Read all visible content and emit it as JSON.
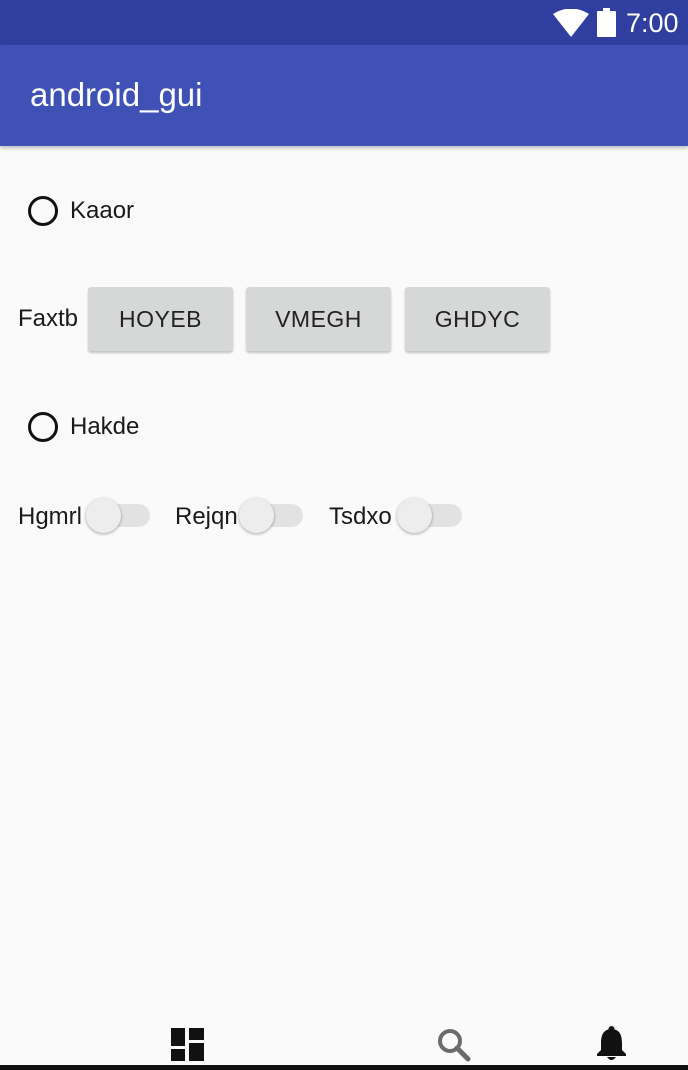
{
  "status_bar": {
    "time": "7:00",
    "icons": [
      "wifi-icon",
      "battery-icon"
    ]
  },
  "app_bar": {
    "title": "android_gui"
  },
  "radios": [
    {
      "label": "Kaaor",
      "checked": false
    },
    {
      "label": "Hakde",
      "checked": false
    }
  ],
  "button_group": {
    "label": "Faxtb",
    "buttons": [
      "HOYEB",
      "VMEGH",
      "GHDYC"
    ]
  },
  "switches": [
    {
      "label": "Hgmrl",
      "on": false
    },
    {
      "label": "Rejqn",
      "on": false
    },
    {
      "label": "Tsdxo",
      "on": false
    }
  ],
  "bottom_nav": {
    "icons": [
      "dashboard-icon",
      "search-icon",
      "notifications-icon"
    ]
  },
  "colors": {
    "status_bar": "#303f9f",
    "app_bar": "#3f51b5",
    "background": "#fafafa",
    "button": "#d6d7d7"
  }
}
